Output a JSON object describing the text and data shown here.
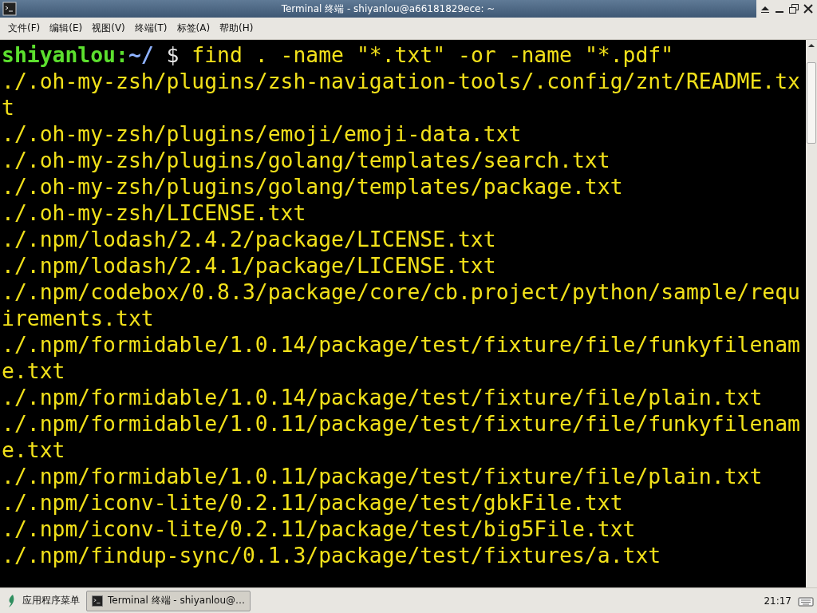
{
  "window": {
    "title": "Terminal 终端 - shiyanlou@a66181829ece: ~"
  },
  "menu": [
    "文件(F)",
    "编辑(E)",
    "视图(V)",
    "终端(T)",
    "标签(A)",
    "帮助(H)"
  ],
  "terminal": {
    "lines": [
      {
        "kind": "prompt",
        "user": "shiyanlou",
        "sep": ":",
        "path": "~/",
        "symbol": "$",
        "command": "find . -name \"*.txt\" -or -name \"*.pdf\""
      },
      {
        "kind": "output",
        "text": "./.oh-my-zsh/plugins/zsh-navigation-tools/.config/znt/README.tx"
      },
      {
        "kind": "output",
        "text": "t"
      },
      {
        "kind": "output",
        "text": "./.oh-my-zsh/plugins/emoji/emoji-data.txt"
      },
      {
        "kind": "output",
        "text": "./.oh-my-zsh/plugins/golang/templates/search.txt"
      },
      {
        "kind": "output",
        "text": "./.oh-my-zsh/plugins/golang/templates/package.txt"
      },
      {
        "kind": "output",
        "text": "./.oh-my-zsh/LICENSE.txt"
      },
      {
        "kind": "output",
        "text": "./.npm/lodash/2.4.2/package/LICENSE.txt"
      },
      {
        "kind": "output",
        "text": "./.npm/lodash/2.4.1/package/LICENSE.txt"
      },
      {
        "kind": "output",
        "text": "./.npm/codebox/0.8.3/package/core/cb.project/python/sample/requ"
      },
      {
        "kind": "output",
        "text": "irements.txt"
      },
      {
        "kind": "output",
        "text": "./.npm/formidable/1.0.14/package/test/fixture/file/funkyfilenam"
      },
      {
        "kind": "output",
        "text": "e.txt"
      },
      {
        "kind": "output",
        "text": "./.npm/formidable/1.0.14/package/test/fixture/file/plain.txt"
      },
      {
        "kind": "output",
        "text": "./.npm/formidable/1.0.11/package/test/fixture/file/funkyfilenam"
      },
      {
        "kind": "output",
        "text": "e.txt"
      },
      {
        "kind": "output",
        "text": "./.npm/formidable/1.0.11/package/test/fixture/file/plain.txt"
      },
      {
        "kind": "output",
        "text": "./.npm/iconv-lite/0.2.11/package/test/gbkFile.txt"
      },
      {
        "kind": "output",
        "text": "./.npm/iconv-lite/0.2.11/package/test/big5File.txt"
      },
      {
        "kind": "output",
        "text": "./.npm/findup-sync/0.1.3/package/test/fixtures/a.txt"
      }
    ]
  },
  "taskbar": {
    "menu_label": "应用程序菜单",
    "tasks": [
      {
        "label": "Terminal 终端 - shiyanlou@…",
        "selected": true
      }
    ],
    "clock": "21:17"
  }
}
